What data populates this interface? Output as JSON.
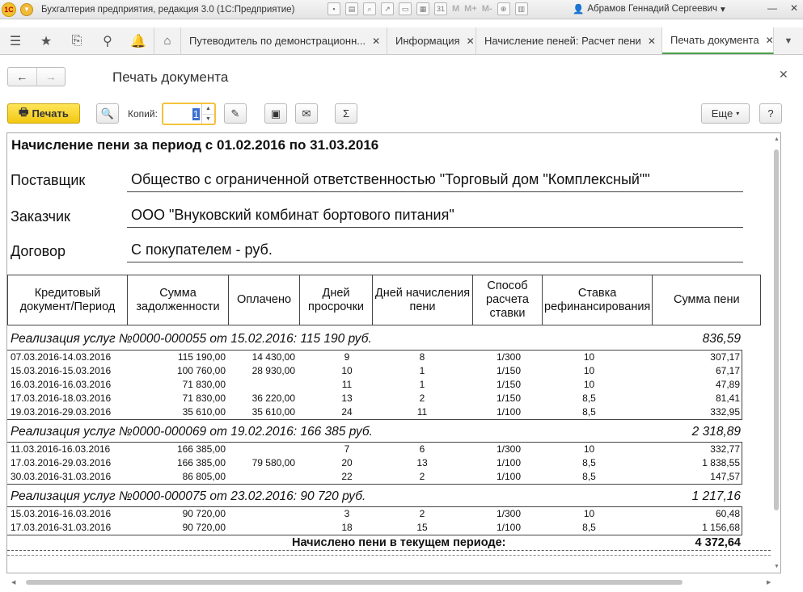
{
  "window": {
    "title": "Бухгалтерия предприятия, редакция 3.0  (1С:Предприятие)",
    "user": "Абрамов Геннадий Сергеевич",
    "memory_buttons": [
      "M",
      "M+",
      "M-"
    ]
  },
  "tabs": [
    {
      "label": "Путеводитель по демонстрационн..."
    },
    {
      "label": "Информация"
    },
    {
      "label": "Начисление пеней: Расчет пени"
    },
    {
      "label": "Печать документа"
    }
  ],
  "form": {
    "title": "Печать документа"
  },
  "toolbar": {
    "print_label": "Печать",
    "copies_label": "Копий:",
    "copies_value": "1",
    "more_label": "Еще",
    "help_label": "?",
    "sigma_label": "Σ"
  },
  "document": {
    "title": "Начисление пени за период с 01.02.2016 по 31.03.2016",
    "supplier_label": "Поставщик",
    "supplier_value": "Общество с ограниченной ответственностью \"Торговый дом \"Комплексный\"\"",
    "customer_label": "Заказчик",
    "customer_value": "ООО \"Внуковский комбинат бортового питания\"",
    "contract_label": "Договор",
    "contract_value": "С покупателем - руб.",
    "columns": [
      "Кредитовый документ/Период",
      "Сумма задолженности",
      "Оплачено",
      "Дней просрочки",
      "Дней начисления пени",
      "Способ расчета ставки",
      "Ставка рефинансирования",
      "Сумма пени"
    ],
    "groups": [
      {
        "name": "Реализация услуг №0000-000055 от 15.02.2016: 115 190 руб.",
        "sum": "836,59",
        "rows": [
          {
            "period": "07.03.2016-14.03.2016",
            "debt": "115 190,00",
            "paid": "14 430,00",
            "days": "9",
            "days_penalty": "8",
            "method": "1/300",
            "rate": "10",
            "sum": "307,17"
          },
          {
            "period": "15.03.2016-15.03.2016",
            "debt": "100 760,00",
            "paid": "28 930,00",
            "days": "10",
            "days_penalty": "1",
            "method": "1/150",
            "rate": "10",
            "sum": "67,17"
          },
          {
            "period": "16.03.2016-16.03.2016",
            "debt": "71 830,00",
            "paid": "",
            "days": "11",
            "days_penalty": "1",
            "method": "1/150",
            "rate": "10",
            "sum": "47,89"
          },
          {
            "period": "17.03.2016-18.03.2016",
            "debt": "71 830,00",
            "paid": "36 220,00",
            "days": "13",
            "days_penalty": "2",
            "method": "1/150",
            "rate": "8,5",
            "sum": "81,41"
          },
          {
            "period": "19.03.2016-29.03.2016",
            "debt": "35 610,00",
            "paid": "35 610,00",
            "days": "24",
            "days_penalty": "11",
            "method": "1/100",
            "rate": "8,5",
            "sum": "332,95"
          }
        ]
      },
      {
        "name": "Реализация услуг №0000-000069 от 19.02.2016: 166 385 руб.",
        "sum": "2 318,89",
        "rows": [
          {
            "period": "11.03.2016-16.03.2016",
            "debt": "166 385,00",
            "paid": "",
            "days": "7",
            "days_penalty": "6",
            "method": "1/300",
            "rate": "10",
            "sum": "332,77"
          },
          {
            "period": "17.03.2016-29.03.2016",
            "debt": "166 385,00",
            "paid": "79 580,00",
            "days": "20",
            "days_penalty": "13",
            "method": "1/100",
            "rate": "8,5",
            "sum": "1 838,55"
          },
          {
            "period": "30.03.2016-31.03.2016",
            "debt": "86 805,00",
            "paid": "",
            "days": "22",
            "days_penalty": "2",
            "method": "1/100",
            "rate": "8,5",
            "sum": "147,57"
          }
        ]
      },
      {
        "name": "Реализация услуг №0000-000075 от 23.02.2016: 90 720 руб.",
        "sum": "1 217,16",
        "rows": [
          {
            "period": "15.03.2016-16.03.2016",
            "debt": "90 720,00",
            "paid": "",
            "days": "3",
            "days_penalty": "2",
            "method": "1/300",
            "rate": "10",
            "sum": "60,48"
          },
          {
            "period": "17.03.2016-31.03.2016",
            "debt": "90 720,00",
            "paid": "",
            "days": "18",
            "days_penalty": "15",
            "method": "1/100",
            "rate": "8,5",
            "sum": "1 156,68"
          }
        ]
      }
    ],
    "total_label": "Начислено пени в текущем периоде:",
    "total_value": "4 372,64"
  }
}
